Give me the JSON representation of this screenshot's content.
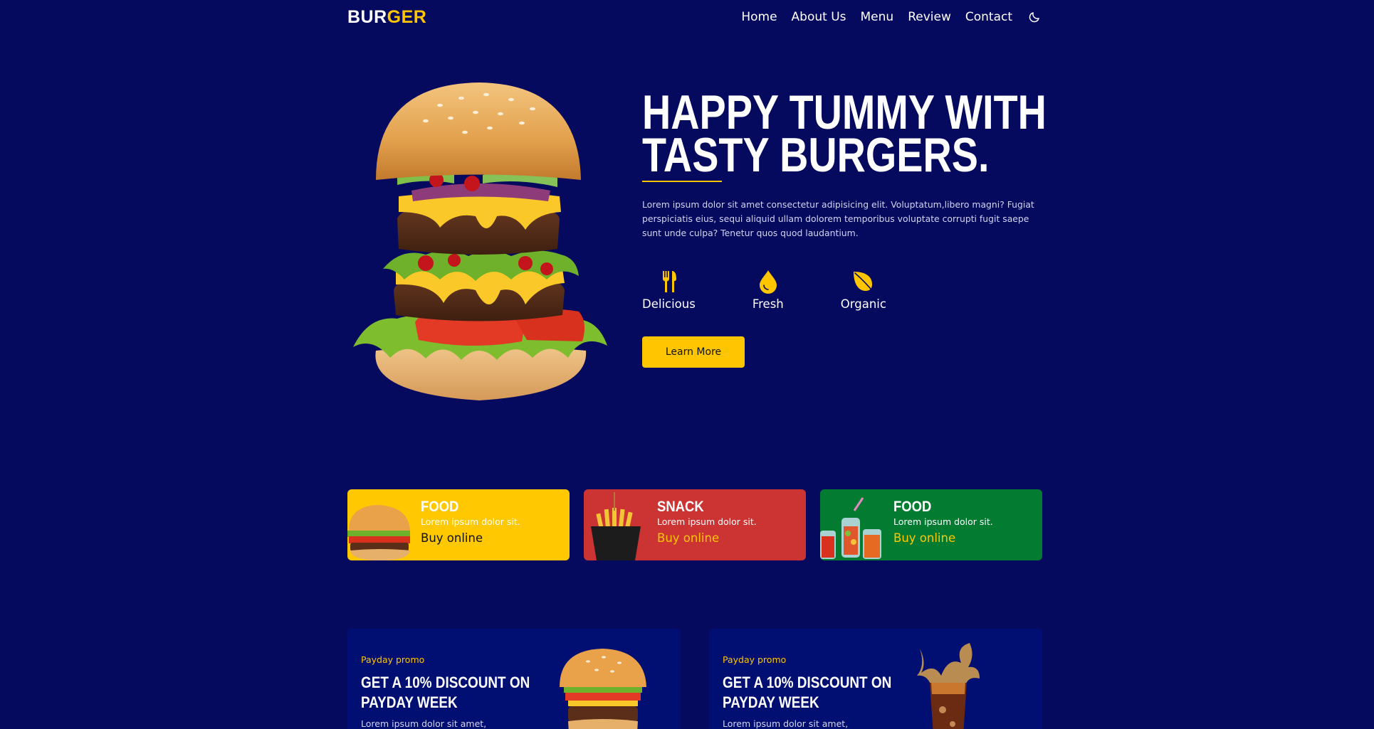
{
  "brand": {
    "logo_part1": "BUR",
    "logo_part2": "GER"
  },
  "nav": {
    "links": [
      "Home",
      "About Us",
      "Menu",
      "Review",
      "Contact"
    ],
    "theme_icon": "moon-icon"
  },
  "hero": {
    "title_line1": "HAPPY TUMMY WITH",
    "title_line2": "TASTY BURGERS.",
    "description": "Lorem ipsum dolor sit amet consectetur adipisicing elit. Voluptatum,libero magni? Fugiat perspiciatis eius, sequi aliquid ullam dolorem temporibus voluptate corrupti fugit saepe sunt unde culpa? Tenetur quos quod laudantium.",
    "features": [
      {
        "label": "Delicious",
        "icon": "utensils-icon"
      },
      {
        "label": "Fresh",
        "icon": "drop-icon"
      },
      {
        "label": "Organic",
        "icon": "leaf-icon"
      }
    ],
    "button_label": "Learn More"
  },
  "cards": [
    {
      "title": "FOOD",
      "subtitle": "Lorem ipsum dolor sit.",
      "link": "Buy online",
      "color": "#ffc800"
    },
    {
      "title": "SNACK",
      "subtitle": "Lorem ipsum dolor sit.",
      "link": "Buy online",
      "color": "#cc3434"
    },
    {
      "title": "FOOD",
      "subtitle": "Lorem ipsum dolor sit.",
      "link": "Buy online",
      "color": "#037c32"
    }
  ],
  "promos": [
    {
      "tag": "Payday promo",
      "title_line1": "GET A 10% DISCOUNT ON",
      "title_line2": "PAYDAY WEEK",
      "description": "Lorem ipsum dolor sit amet,"
    },
    {
      "tag": "Payday promo",
      "title_line1": "GET A 10% DISCOUNT ON",
      "title_line2": "PAYDAY WEEK",
      "description": "Lorem ipsum dolor sit amet,"
    }
  ],
  "colors": {
    "background": "#060a5f",
    "accent": "#ffc600",
    "promo_bg": "#020f72"
  }
}
